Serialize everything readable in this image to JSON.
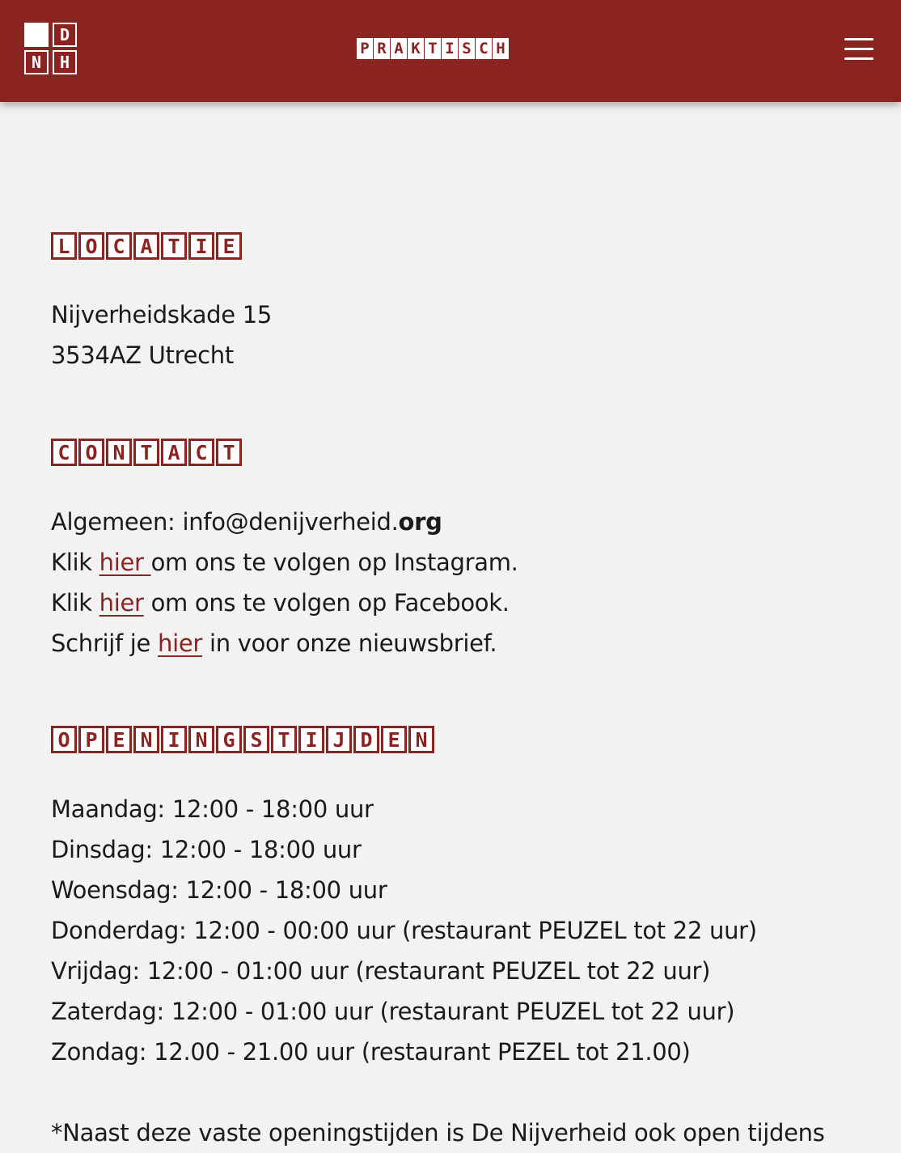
{
  "header": {
    "logo": [
      "",
      "D",
      "N",
      "H"
    ],
    "title": "PRAKTISCH",
    "menu_icon": "hamburger-icon"
  },
  "locatie": {
    "heading": "LOCATIE",
    "lines": [
      "Nijverheidskade 15",
      "3534AZ Utrecht"
    ]
  },
  "contact": {
    "heading": "CONTACT",
    "email_prefix": "Algemeen: info@denijverheid.",
    "email_bold": "org",
    "instagram": {
      "before": "Klik ",
      "link": "hier ",
      "after": "om ons te volgen op Instagram."
    },
    "facebook": {
      "before": "Klik ",
      "link": "hier",
      "after": " om ons te volgen op Facebook."
    },
    "newsletter": {
      "before": "Schrijf je ",
      "link": "hier",
      "after": " in voor onze nieuwsbrief."
    }
  },
  "openingstijden": {
    "heading": "OPENINGSTIJDEN",
    "lines": [
      "Maandag: 12:00 - 18:00 uur",
      "Dinsdag: 12:00 - 18:00 uur",
      "Woensdag: 12:00 - 18:00 uur",
      "Donderdag: 12:00 - 00:00 uur (restaurant PEUZEL tot 22 uur)",
      "Vrijdag: 12:00 - 01:00 uur (restaurant PEUZEL tot 22 uur)",
      "Zaterdag: 12:00 - 01:00 uur (restaurant PEUZEL tot 22 uur)",
      "Zondag: 12.00 - 21.00 uur (restaurant PEZEL tot 21.00)"
    ],
    "note": "*Naast deze vaste openingstijden is De Nijverheid ook open tijdens"
  }
}
